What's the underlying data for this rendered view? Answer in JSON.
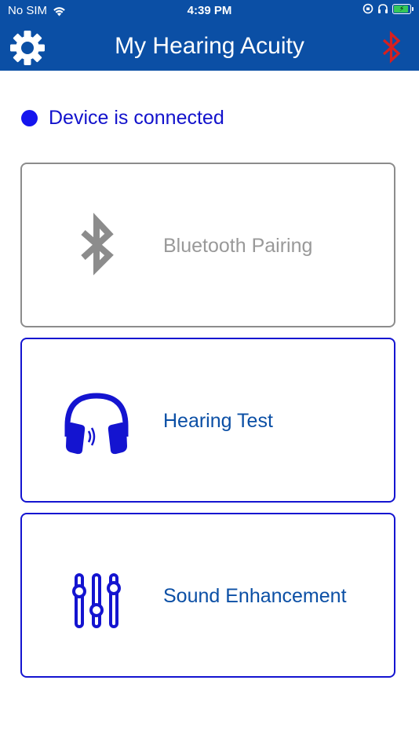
{
  "status_bar": {
    "carrier": "No SIM",
    "time": "4:39 PM"
  },
  "app_bar": {
    "title": "My Hearing Acuity",
    "settings_icon": "gear-icon",
    "bluetooth_icon": "bluetooth-icon",
    "bluetooth_icon_color": "#d62020"
  },
  "connection": {
    "status_text": "Device is connected",
    "dot_color": "#1515ee"
  },
  "menu": {
    "items": [
      {
        "label": "Bluetooth Pairing",
        "icon": "bluetooth-icon",
        "enabled": false
      },
      {
        "label": "Hearing Test",
        "icon": "headphones-icon",
        "enabled": true
      },
      {
        "label": "Sound Enhancement",
        "icon": "equalizer-sliders-icon",
        "enabled": true
      }
    ]
  },
  "colors": {
    "header_bg": "#0b4fa5",
    "accent": "#1414d0",
    "disabled": "#8c8c8c"
  }
}
